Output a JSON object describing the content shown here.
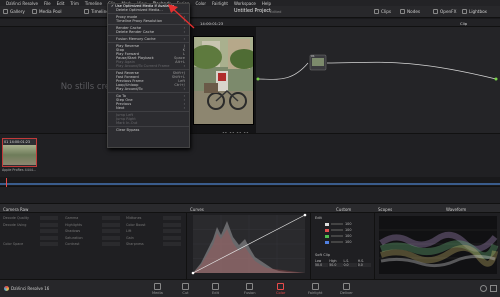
{
  "menubar": {
    "items": [
      "DaVinci Resolve",
      "File",
      "Edit",
      "Trim",
      "Timeline",
      "Clip",
      "Mark",
      "View",
      "Playback",
      "Fusion",
      "Color",
      "Fairlight",
      "Workspace",
      "Help"
    ],
    "active": "Playback"
  },
  "toolbar": {
    "gallery": "Gallery",
    "media_pool": "Media Pool",
    "timelines": "Timelines",
    "project_title": "Untitled Project",
    "project_status": "Edited",
    "clips": "Clips",
    "nodes": "Nodes",
    "openfx": "OpenFX",
    "lightbox": "Lightbox"
  },
  "viewerbar": {
    "timecode_top": "14:00:01:23",
    "clip_label": "Clip"
  },
  "gallery": {
    "empty_text": "No stills created"
  },
  "viewer": {
    "timecode": "01:00:00:00"
  },
  "playback_menu": {
    "items": [
      {
        "label": "Use Optimized Media If Available",
        "checked": true,
        "top": true
      },
      {
        "label": "Delete Optimized Media...",
        "disabled": false
      },
      {
        "sep": true
      },
      {
        "label": "Proxy mode",
        "arrow": "›"
      },
      {
        "label": "Timeline Proxy Resolution",
        "arrow": "›"
      },
      {
        "sep": true
      },
      {
        "label": "Render Cache",
        "arrow": "›"
      },
      {
        "label": "Delete Render Cache",
        "arrow": "›"
      },
      {
        "sep": true
      },
      {
        "label": "Fusion Memory Cache",
        "arrow": "›"
      },
      {
        "sep": true
      },
      {
        "label": "Play Reverse",
        "shortcut": "J"
      },
      {
        "label": "Stop",
        "shortcut": "K"
      },
      {
        "label": "Play Forward",
        "shortcut": "L"
      },
      {
        "label": "Pause/Start Playback",
        "shortcut": "Space"
      },
      {
        "label": "Play Again",
        "shortcut": "Alt+L",
        "disabled": true
      },
      {
        "label": "Play Around/To Current Frame",
        "arrow": "›",
        "disabled": true
      },
      {
        "sep": true
      },
      {
        "label": "Fast Reverse",
        "shortcut": "Shift+J"
      },
      {
        "label": "Fast Forward",
        "shortcut": "Shift+L"
      },
      {
        "label": "Previous Frame",
        "shortcut": "Left"
      },
      {
        "label": "Loop/Unloop",
        "shortcut": "Ctrl+/"
      },
      {
        "label": "Play Around/To",
        "arrow": "›"
      },
      {
        "sep": true
      },
      {
        "label": "Go To",
        "arrow": "›"
      },
      {
        "label": "Step One",
        "arrow": "›"
      },
      {
        "label": "Previous",
        "arrow": "›"
      },
      {
        "label": "Next",
        "arrow": "›"
      },
      {
        "sep": true
      },
      {
        "label": "Jump Left",
        "disabled": true
      },
      {
        "label": "Jump Right",
        "disabled": true
      },
      {
        "label": "Mark In-Out",
        "disabled": true
      },
      {
        "sep": true
      },
      {
        "label": "Clear Bypass",
        "disabled": false
      }
    ]
  },
  "clips": {
    "clip_number": "01",
    "clip_timecode": "14:00:01:23",
    "clip_label": "Apple ProRes 4444..."
  },
  "panels": {
    "camera_raw": "Camera Raw",
    "curves": "Curves",
    "custom": "Custom",
    "scopes": "Scopes",
    "waveform": "Waveform",
    "soft_clip": "Soft Clip",
    "edit": "Edit",
    "values": [
      "100",
      "100",
      "100",
      "100"
    ],
    "soft_clip_values": [
      "Low",
      "High",
      "L.S.",
      "H.S."
    ],
    "soft_clip_nums": [
      "50.0",
      "50.0",
      "0.0",
      "0.0"
    ],
    "camera_raw_rows": [
      "Decode Quality",
      "Decode Using",
      "",
      "",
      "Color Space",
      "Gamma",
      "Highlights",
      "Shadows",
      "Saturation",
      "Contrast",
      "Midtones",
      "Color Boost",
      "Lift",
      "Gain",
      "Sharpness"
    ]
  },
  "bottom_nav": {
    "app_name": "DaVinci Resolve 16",
    "items": [
      "Media",
      "Cut",
      "Edit",
      "Fusion",
      "Color",
      "Fairlight",
      "Deliver"
    ],
    "active": "Color"
  },
  "colors": {
    "accent": "#e84b4b",
    "playhead": "#3a5c8c"
  }
}
